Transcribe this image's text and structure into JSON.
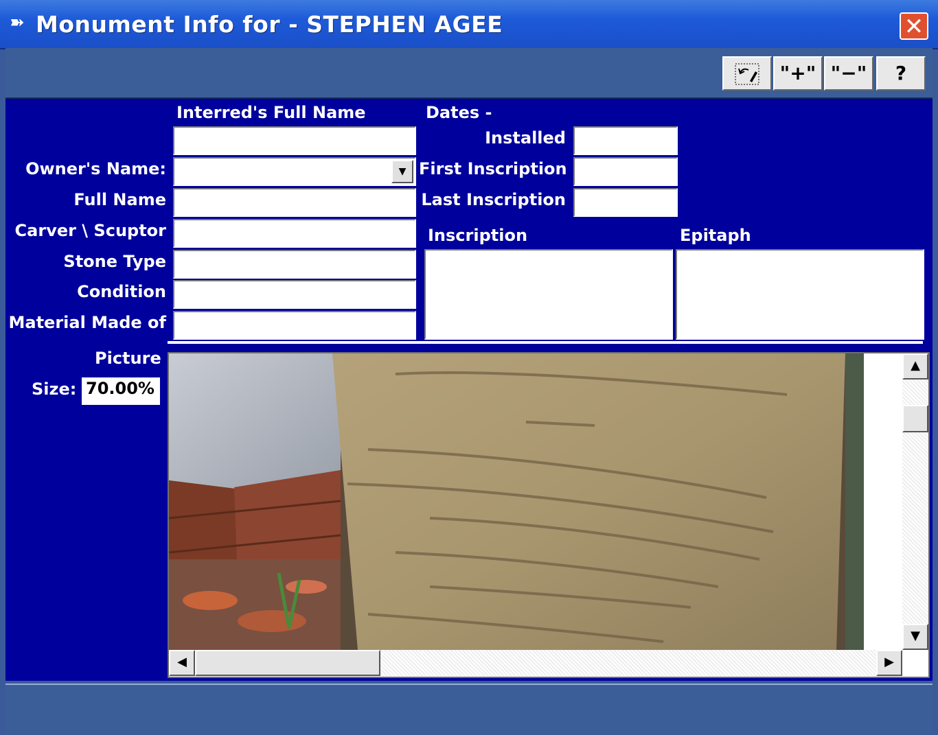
{
  "window": {
    "title": "Monument Info for - STEPHEN AGEE",
    "close_label": "✕",
    "title_icon": "arrow-icon"
  },
  "toolbar": {
    "undo_label": "↶",
    "add_label": "\"+\"",
    "remove_label": "\"−\"",
    "help_label": "?"
  },
  "form": {
    "interred_header": "Interred's Full Name",
    "interred_value": "",
    "owner_label": "Owner's Name:",
    "owner_value": "",
    "fullname_label": "Full Name",
    "fullname_value": "",
    "carver_label": "Carver \\ Scuptor",
    "carver_value": "",
    "stonetype_label": "Stone Type",
    "stonetype_value": "",
    "condition_label": "Condition",
    "condition_value": "",
    "material_label": "Material Made of",
    "material_value": "",
    "dates_header": "Dates -",
    "installed_label": "Installed",
    "installed_value": "",
    "first_inscription_label": "First Inscription",
    "first_inscription_value": "",
    "last_inscription_label": "Last Inscription",
    "last_inscription_value": "",
    "inscription_header": "Inscription",
    "inscription_value": "",
    "epitaph_header": "Epitaph",
    "epitaph_value": ""
  },
  "picture": {
    "label": "Picture",
    "size_label": "Size:",
    "size_value": "70.00%",
    "image_subject": "gravestone-photo"
  }
}
